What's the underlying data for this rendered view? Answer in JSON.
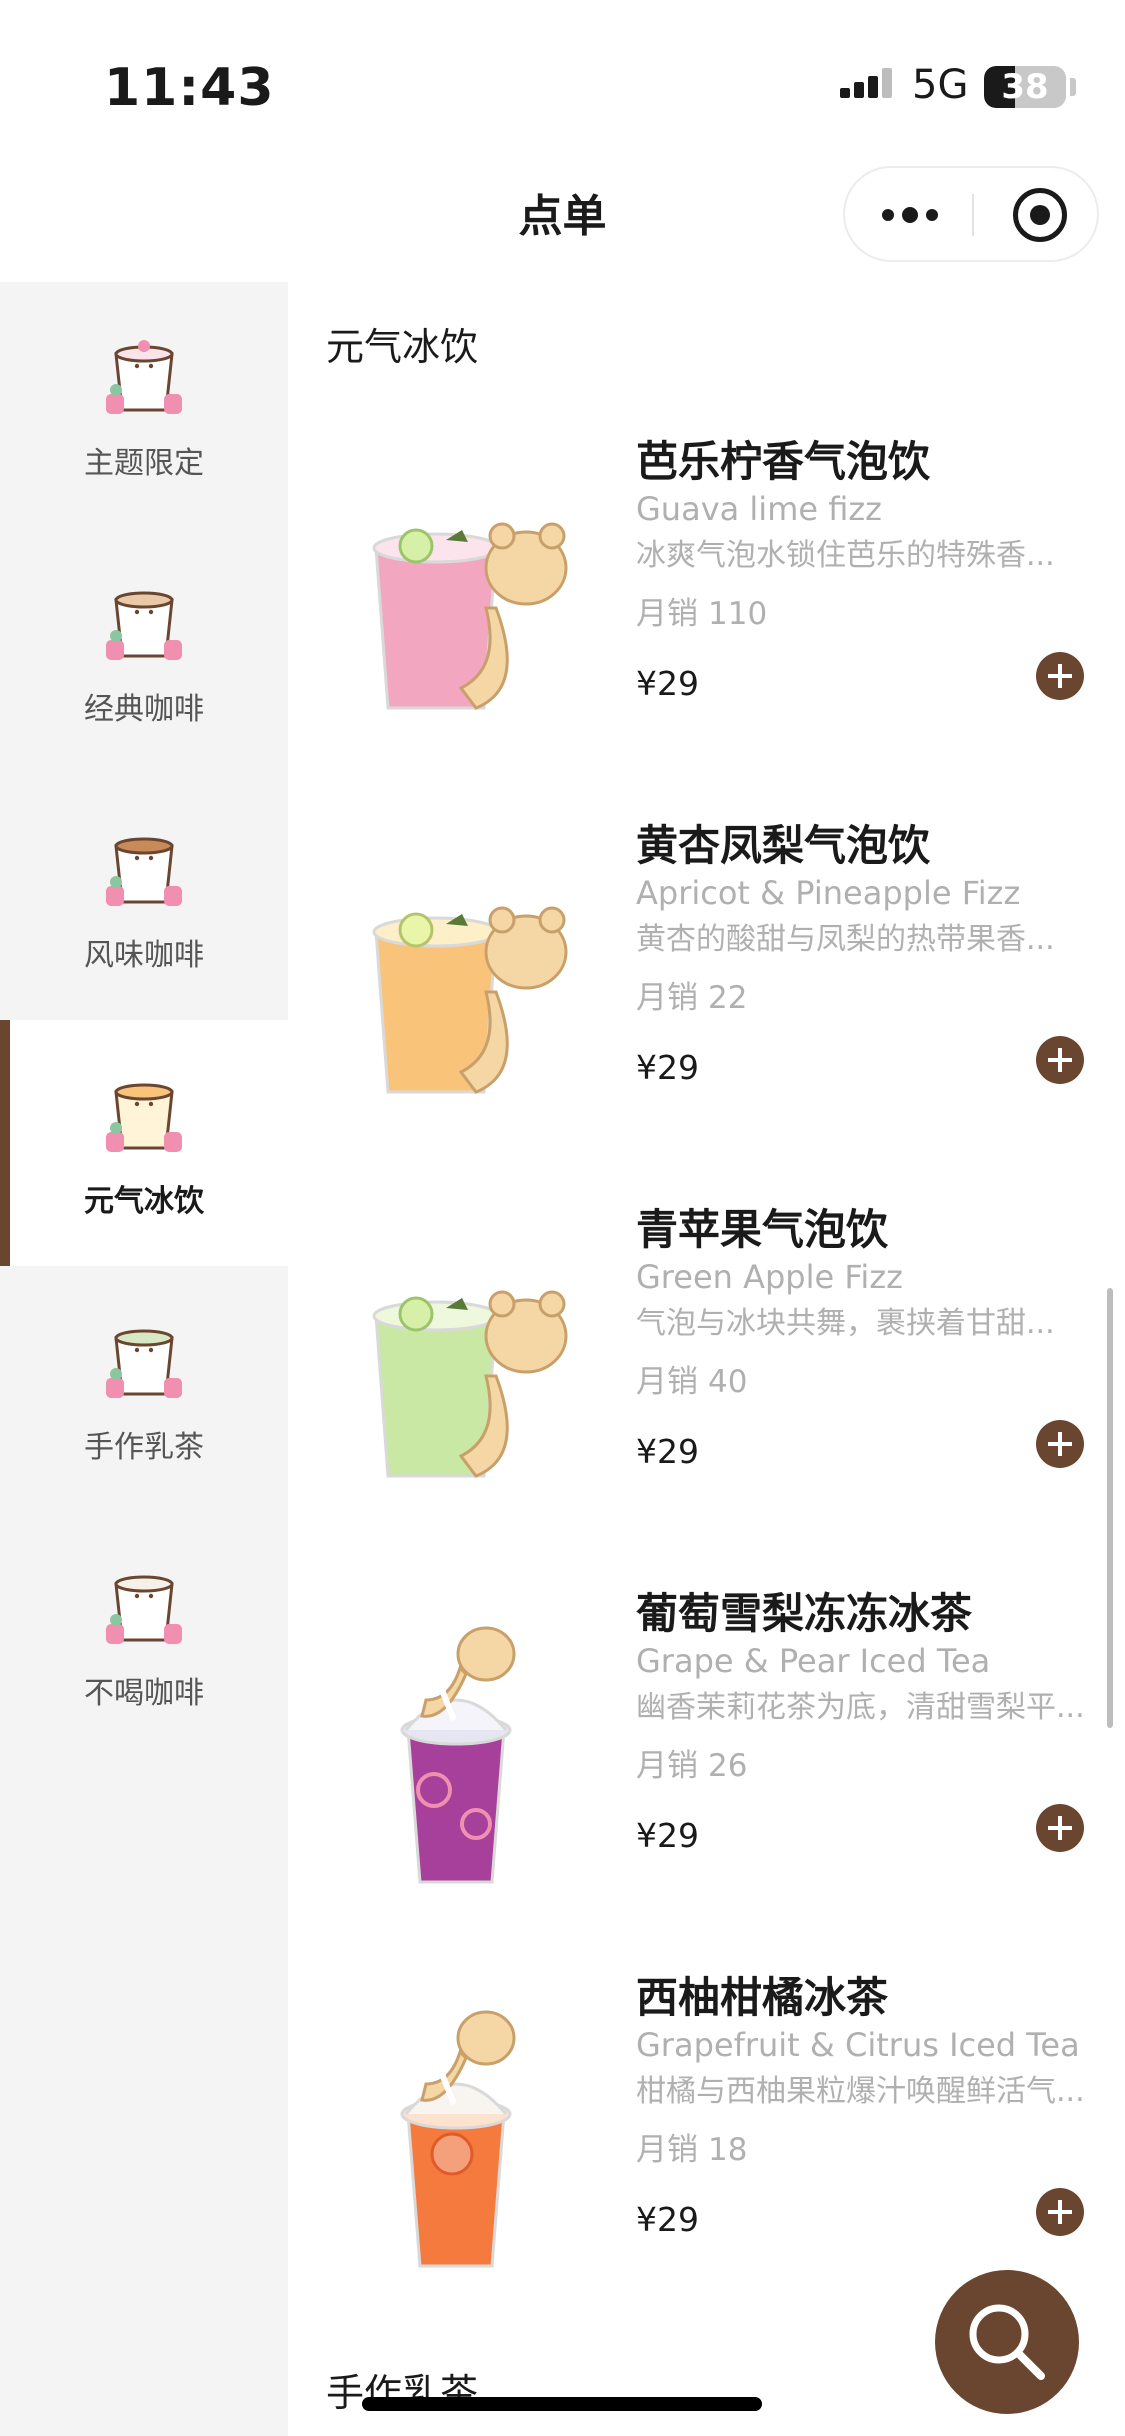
{
  "status_bar": {
    "time": "11:43",
    "network": "5G",
    "battery": "38",
    "battery_level": 0.38
  },
  "nav": {
    "title": "点单",
    "more_icon": "more-dots-icon",
    "close_icon": "target-icon"
  },
  "colors": {
    "accent": "#6a4631",
    "sidebar_bg": "#f4f4f4",
    "muted_text": "#b0b0b0"
  },
  "sidebar": {
    "items": [
      {
        "label": "主题限定",
        "active": false
      },
      {
        "label": "经典咖啡",
        "active": false
      },
      {
        "label": "风味咖啡",
        "active": false
      },
      {
        "label": "元气冰饮",
        "active": true
      },
      {
        "label": "手作乳茶",
        "active": false
      },
      {
        "label": "不喝咖啡",
        "active": false
      }
    ]
  },
  "main": {
    "section_title": "元气冰饮",
    "next_section_title": "手作乳茶",
    "sales_label": "月销",
    "products": [
      {
        "name": "芭乐柠香气泡饮",
        "en": "Guava lime fizz",
        "desc": "冰爽气泡水锁住芭乐的特殊香...",
        "sales": "110",
        "price": "¥29",
        "drink_color": "#f2a6c0"
      },
      {
        "name": "黄杏凤梨气泡饮",
        "en": "Apricot & Pineapple Fizz",
        "desc": "黄杏的酸甜与凤梨的热带果香...",
        "sales": "22",
        "price": "¥29",
        "drink_color": "#f9c37a"
      },
      {
        "name": "青苹果气泡饮",
        "en": "Green Apple Fizz",
        "desc": "气泡与冰块共舞，裹挟着甘甜...",
        "sales": "40",
        "price": "¥29",
        "drink_color": "#c8e8a4"
      },
      {
        "name": "葡萄雪梨冻冻冰茶",
        "en": "Grape & Pear Iced Tea",
        "desc": "幽香茉莉花茶为底，清甜雪梨平...",
        "sales": "26",
        "price": "¥29",
        "drink_color": "#a7409a"
      },
      {
        "name": "西柚柑橘冰茶",
        "en": "Grapefruit & Citrus Iced Tea",
        "desc": "柑橘与西柚果粒爆汁唤醒鲜活气...",
        "sales": "18",
        "price": "¥29",
        "drink_color": "#f57a3e"
      }
    ]
  },
  "search": {
    "icon": "search-icon"
  }
}
